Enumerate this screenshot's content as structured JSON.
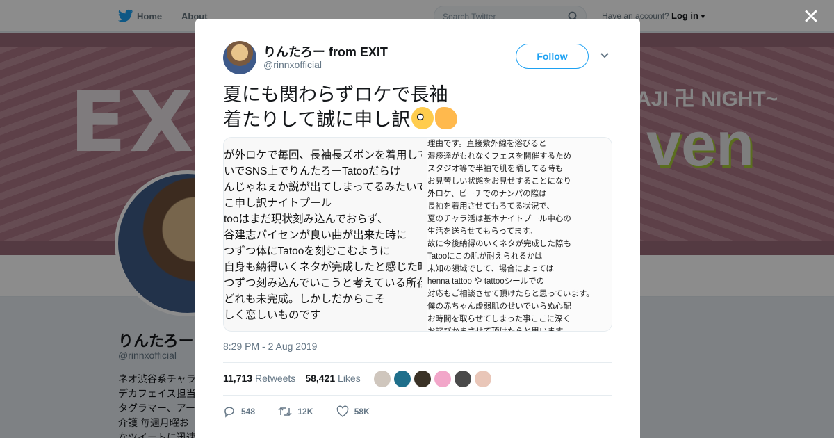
{
  "topbar": {
    "home": "Home",
    "about": "About",
    "search_placeholder": "Search Twitter",
    "have_account": "Have an account?",
    "login": "Log in"
  },
  "banner": {
    "exit_text": "EXI",
    "night_text": "AJI 卍 NIGHT~",
    "heaven_text": "ven"
  },
  "profile": {
    "name": "りんたろー",
    "handle": "@rinnxofficial",
    "bio_lines": [
      "ネオ渋谷系チャラ",
      "デカフェイス担当",
      "タグラマー、アー",
      "介護 毎週月曜お",
      "なツイートに迅速"
    ]
  },
  "tweet": {
    "author_name": "りんたろー from EXIT",
    "author_handle": "@rinnxofficial",
    "follow_label": "Follow",
    "text_line1": "夏にも関わらずロケで長袖",
    "text_line2": "着たりして誠に申し訳",
    "media_left_lines": [
      "が外ロケで毎回、長袖長ズボンを着用して",
      "いでSNS上でりんたろーTatooだらけ",
      "んじゃねぇか説が出てしまってるみたいで",
      "こ申し訳ナイトプール",
      "tooはまだ現状刻み込んでおらず、",
      "谷建志パイセンが良い曲が出来た時に",
      "つずつ体にTatooを刻むこむように",
      "自身も納得いくネタが完成したと感じた時",
      "つずつ刻み込んでいこうと考えている所存",
      "どれも未完成。しかしだからこそ",
      "しく恋しいものです"
    ],
    "media_right_lines": [
      "理由です。直接紫外線を浴びると",
      "湿疹達がもれなくフェスを開催するため",
      "スタジオ等で半袖で肌を晒してる時も",
      "お見苦しい状態をお見せすることになり",
      "外ロケ、ビーチでのナンパの際は",
      "長袖を着用させてもろてる状況で、",
      "夏のチャラ活は基本ナイトプール中心の",
      "生活を送らせてもらってます。",
      "故に今後納得のいくネタが完成した際も",
      "Tatooにこの肌が耐えられるかは",
      "未知の領域でして、場合によっては",
      "henna tattoo や tattooシールでの",
      "対応もご相談させて頂けたらと思っています。",
      "僕の赤ちゃん虚弱肌のせいでいらぬ心配",
      "お時間を取らせてしまった事ここに深く",
      "お詫びかまさせて頂けたらと思います。"
    ],
    "timestamp": "8:29 PM - 2 Aug 2019",
    "retweets_count": "11,713",
    "retweets_label": "Retweets",
    "likes_count": "58,421",
    "likes_label": "Likes",
    "reply_count": "548",
    "retweet_action_count": "12K",
    "like_action_count": "58K"
  },
  "colors": {
    "accent": "#1da1f2",
    "text": "#14171a",
    "muted": "#657786",
    "likers": [
      "#cfc6bd",
      "#1f6f8b",
      "#3a3226",
      "#f2a6c9",
      "#4a4a4a",
      "#e9c6b8"
    ]
  },
  "icons": [
    "twitter-bird-icon",
    "search-icon",
    "caret-down-icon",
    "close-icon",
    "chevron-down-icon",
    "reply-icon",
    "retweet-icon",
    "heart-icon"
  ]
}
